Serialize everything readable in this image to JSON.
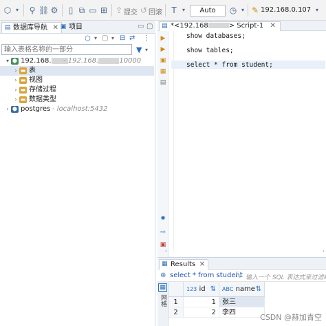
{
  "toolbar": {
    "commit_label": "提交",
    "rollback_label": "回滚",
    "transaction_mode": "Auto",
    "connection": "192.168.0.107"
  },
  "navigator": {
    "tab_navigator": "数据库导航",
    "tab_projects": "项目",
    "search_placeholder": "输入表格名称的一部分",
    "tree": [
      {
        "label": "192.168.",
        "detail": "- 192.168.",
        "detail_suffix": "10000"
      },
      {
        "label": "表"
      },
      {
        "label": "视图"
      },
      {
        "label": "存储过程"
      },
      {
        "label": "数据类型"
      },
      {
        "label": "postgres",
        "detail": "- localhost:5432"
      }
    ]
  },
  "editor": {
    "tab_label": "*<192.168",
    "tab_suffix": "> Script-1",
    "lines": [
      "show databases;",
      "show tables;",
      "select * from student;"
    ]
  },
  "results": {
    "tab_label": "Results",
    "query": "select * from student",
    "filter_placeholder": "输入一个 SQL 表达式来过滤结果",
    "side_label": "网格",
    "columns": [
      {
        "type_badge": "123",
        "name": "id"
      },
      {
        "type_badge": "ABC",
        "name": "name"
      }
    ],
    "rows": [
      {
        "num": "1",
        "id": "1",
        "name": "张三"
      },
      {
        "num": "2",
        "id": "2",
        "name": "李四"
      }
    ]
  },
  "watermark": "CSDN @赫加青空",
  "colors": {
    "accent": "#2a6ebb",
    "folder": "#d9a43a",
    "selected_row": "#dde6f1",
    "current_line": "#e8f0fb"
  }
}
